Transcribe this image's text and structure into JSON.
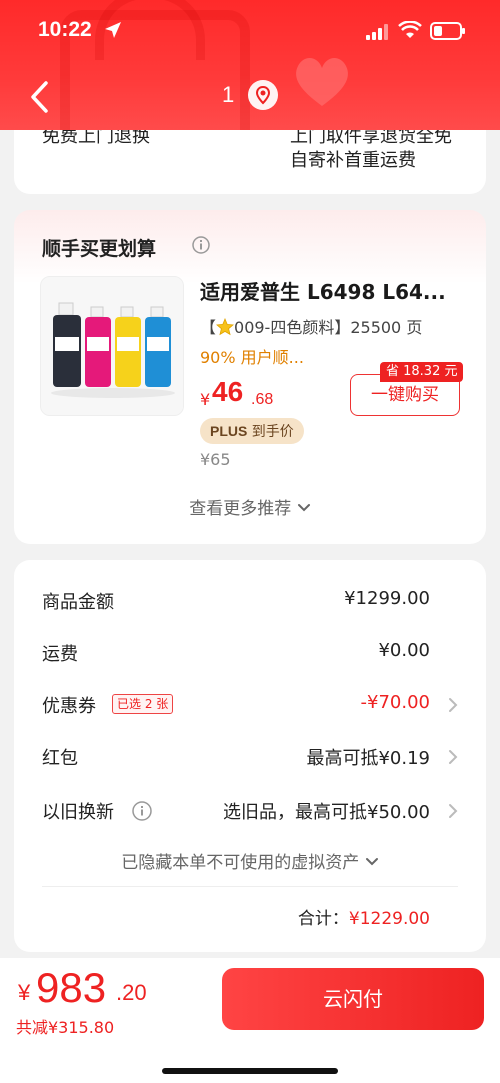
{
  "status_bar": {
    "time": "10:22"
  },
  "nav": {
    "count": "1"
  },
  "top_card": {
    "label": "免费上门退换",
    "info_line1": "上门取件享退货全免",
    "info_line2": "自寄补首重运费"
  },
  "recommend": {
    "title": "顺手买更划算",
    "product": {
      "name": "适用爱普生 L6498 L64...",
      "spec_prefix": "【",
      "spec_text": "009-四色颜料】25500 页",
      "users": "90% 用户顺...",
      "price_currency": "¥",
      "price_int": "46",
      "price_dec": ".68",
      "plus_label": "PLUS",
      "plus_text": "到手价",
      "orig_price": "¥65",
      "save_tag": "省 18.32 元",
      "buy_label": "一键购买"
    },
    "more_label": "查看更多推荐"
  },
  "summary": {
    "rows": [
      {
        "label": "商品金额",
        "value": "¥1299.00"
      },
      {
        "label": "运费",
        "value": "¥0.00"
      },
      {
        "label": "优惠券",
        "badge": "已选 2 张",
        "value": "-¥70.00"
      },
      {
        "label": "红包",
        "value": "最高可抵¥0.19"
      },
      {
        "label": "以旧换新",
        "value": "选旧品，最高可抵¥50.00"
      }
    ],
    "hidden_note": "已隐藏本单不可使用的虚拟资产",
    "total_label": "合计：",
    "total_value": "¥1229.00"
  },
  "bottom": {
    "currency": "¥",
    "pay_int": "983",
    "pay_dec": ".20",
    "saved": "共减¥315.80",
    "pay_button": "云闪付"
  },
  "colors": {
    "brand_red": "#ee2222",
    "header_red": "#ff2a2a",
    "plus_gold": "#f6e3c8"
  }
}
